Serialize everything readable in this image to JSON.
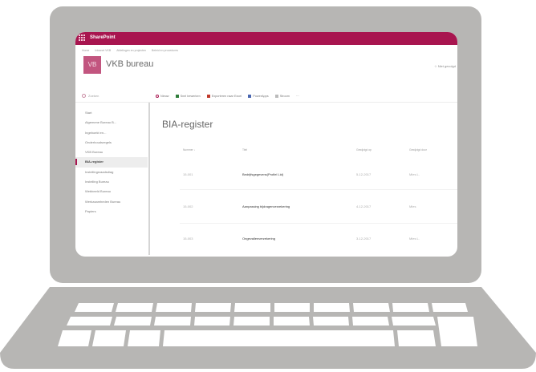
{
  "app": {
    "title": "SharePoint",
    "brand_color": "#a8154f"
  },
  "hub_nav": [
    "Home",
    "Intranet VKB",
    "Afdelingen en projecten",
    "Beleid en procedures"
  ],
  "site": {
    "logo_text": "VB",
    "title": "VKB bureau",
    "follow_label": "☆ Niet gevolgd"
  },
  "search": {
    "placeholder": "Zoeken"
  },
  "command_bar": [
    "Nieuw",
    "Snel bewerken",
    "Exporteren naar Excel",
    "PowerApps",
    "Stroom",
    "···"
  ],
  "left_nav": [
    {
      "label": "Start",
      "active": false
    },
    {
      "label": "Algemene Bureau B...",
      "active": false
    },
    {
      "label": "Ingeboekt en...",
      "active": false
    },
    {
      "label": "Onderhoudsregels",
      "active": false
    },
    {
      "label": "VKB Bureau",
      "active": false
    },
    {
      "label": "BIA-register",
      "active": true
    },
    {
      "label": "Instellingsraadsdiag",
      "active": false
    },
    {
      "label": "Instelling Bureau",
      "active": false
    },
    {
      "label": "Webbeeld Bureau",
      "active": false
    },
    {
      "label": "Werkzaamheden Bureau",
      "active": false
    },
    {
      "label": "Papiers",
      "active": false
    }
  ],
  "page": {
    "title": "BIA-register"
  },
  "table": {
    "headers": [
      "Nummer ↓",
      "Titel",
      "Gewijzigd op",
      "Gewijzigd door"
    ],
    "rows": [
      [
        "15-001",
        "Bedrijfsgegevens(Profiel Lid)",
        "5-12-2017",
        "Mies L."
      ],
      [
        "15-002",
        "Aanpassing bijdragenverzekering",
        "4-12-2017",
        "Mies"
      ],
      [
        "15-003",
        "Ongevallenverzekering",
        "3-12-2017",
        "Mies L."
      ]
    ]
  }
}
